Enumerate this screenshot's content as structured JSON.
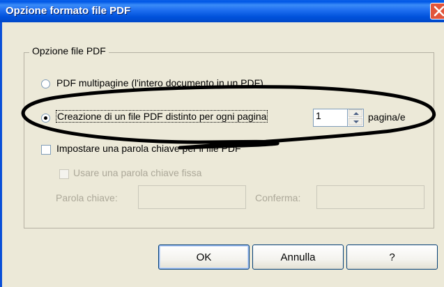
{
  "window": {
    "title": "Opzione formato file PDF"
  },
  "group": {
    "label": "Opzione file PDF"
  },
  "options": {
    "multipage_label": "PDF multipagine (l'intero documento in un PDF)",
    "per_page_label": "Creazione di un file PDF distinto per ogni pagina",
    "pages_value": "1",
    "pages_unit": "pagina/e",
    "selected": "per_page"
  },
  "password": {
    "set_keyword_label": "Impostare una parola chiave per il file PDF",
    "fixed_keyword_label": "Usare una parola chiave fissa",
    "keyword_label": "Parola chiave:",
    "confirm_label": "Conferma:",
    "keyword_value": "",
    "confirm_value": ""
  },
  "buttons": {
    "ok": "OK",
    "cancel": "Annulla",
    "help": "?"
  },
  "icons": [
    "close-icon",
    "radio-icon",
    "checkbox-icon",
    "spin-up-icon",
    "spin-down-icon"
  ],
  "colors": {
    "titlebar": "#0058e6",
    "dialog_bg": "#ece9d8",
    "close_button": "#e2553b",
    "disabled_text": "#aca899",
    "annotation": "#000000"
  }
}
